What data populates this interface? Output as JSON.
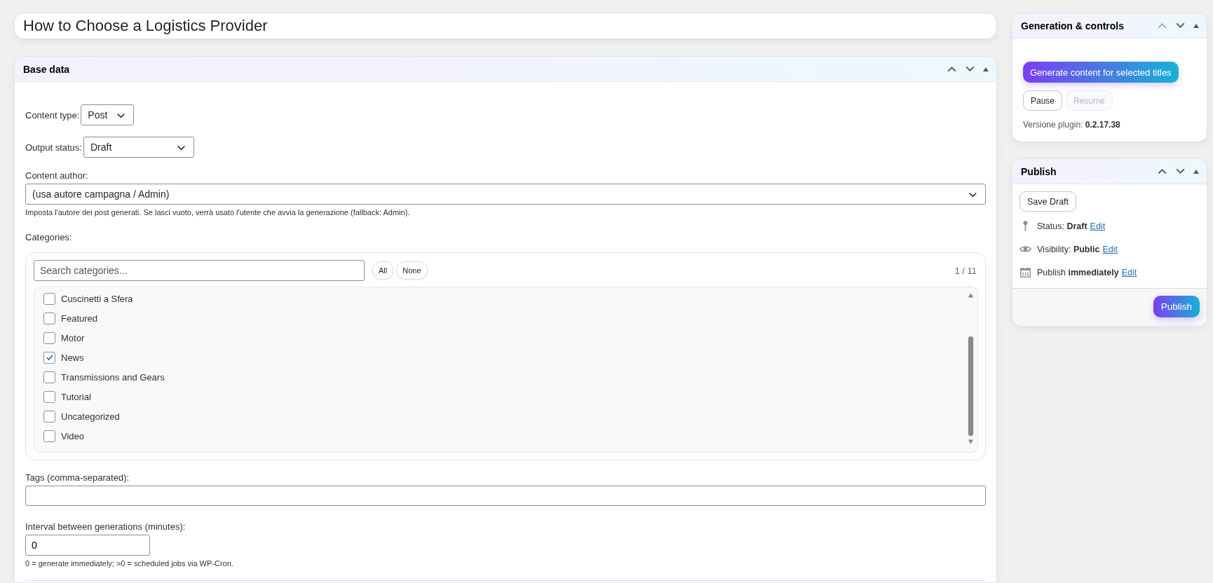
{
  "title_field": {
    "value": "How to Choose a Logistics Provider"
  },
  "base_panel": {
    "title": "Base data",
    "content_type": {
      "label": "Content type:",
      "value": "Post"
    },
    "output_status": {
      "label": "Output status:",
      "value": "Draft"
    },
    "content_author": {
      "label": "Content author:",
      "value": "(usa autore campagna / Admin)",
      "help": "Imposta l'autore dei post generati. Se lasci vuoto, verrà usato l'utente che avvia la generazione (fallback: Admin)."
    },
    "categories": {
      "label": "Categories:",
      "search_placeholder": "Search categories...",
      "all_button": "All",
      "none_button": "None",
      "count": "1 / 11",
      "items": [
        {
          "label": "Cuscinetti a Sfera",
          "checked": false
        },
        {
          "label": "Featured",
          "checked": false
        },
        {
          "label": "Motor",
          "checked": false
        },
        {
          "label": "News",
          "checked": true
        },
        {
          "label": "Transmissions and Gears",
          "checked": false
        },
        {
          "label": "Tutorial",
          "checked": false
        },
        {
          "label": "Uncategorized",
          "checked": false
        },
        {
          "label": "Video",
          "checked": false
        }
      ]
    },
    "tags": {
      "label": "Tags (comma-separated):"
    },
    "interval": {
      "label": "Interval between generations (minutes):",
      "value": "0",
      "help": "0 = generate immediately; >0 = scheduled jobs via WP-Cron."
    }
  },
  "generation_panel": {
    "title": "Generation & controls",
    "generate_button": "Generate content for selected titles",
    "buttons": [
      {
        "label": "Pause",
        "disabled": false
      },
      {
        "label": "Resume",
        "disabled": true
      }
    ],
    "version": "Versione plugin: **0.2.17.38**"
  },
  "publish_panel": {
    "title": "Publish",
    "save_button": "Save Draft",
    "rows": [
      {
        "kind": "status",
        "text": "Status: **Draft**",
        "link": "Edit"
      },
      {
        "kind": "visibility",
        "text": "Visibility: **Public**",
        "link": "Edit"
      },
      {
        "kind": "schedule",
        "text": "Publish **immediately**",
        "link": "Edit"
      }
    ],
    "publish_button": "Publish"
  }
}
